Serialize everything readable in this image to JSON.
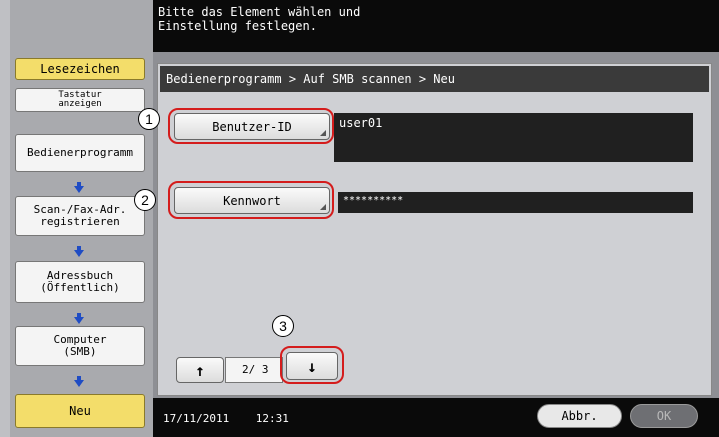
{
  "header": {
    "instruction": "Bitte das Element wählen und\nEinstellung festlegen."
  },
  "sidebar": {
    "bookmark_label": "Lesezeichen",
    "keyboard_label": "Tastatur\nanzeigen",
    "steps": [
      {
        "label": "Bedienerprogramm"
      },
      {
        "label": "Scan-/Fax-Adr.\nregistrieren"
      },
      {
        "label": "Adressbuch\n(Öffentlich)"
      },
      {
        "label": "Computer\n(SMB)"
      }
    ],
    "current_label": "Neu"
  },
  "breadcrumb": "Bedienerprogramm > Auf SMB scannen > Neu",
  "form": {
    "user_id_label": "Benutzer-ID",
    "user_id_value": "user01",
    "password_label": "Kennwort",
    "password_value": "**********"
  },
  "pager": {
    "up_symbol": "↑",
    "down_symbol": "↓",
    "page_text": "2/ 3"
  },
  "callouts": [
    "1",
    "2",
    "3"
  ],
  "footer": {
    "datetime": "17/11/2011    12:31",
    "cancel_label": "Abbr.",
    "ok_label": "OK"
  },
  "colors": {
    "accent_yellow": "#f3dd6a",
    "callout_red": "#d41c1c",
    "arrow_blue": "#1f4cc4"
  }
}
